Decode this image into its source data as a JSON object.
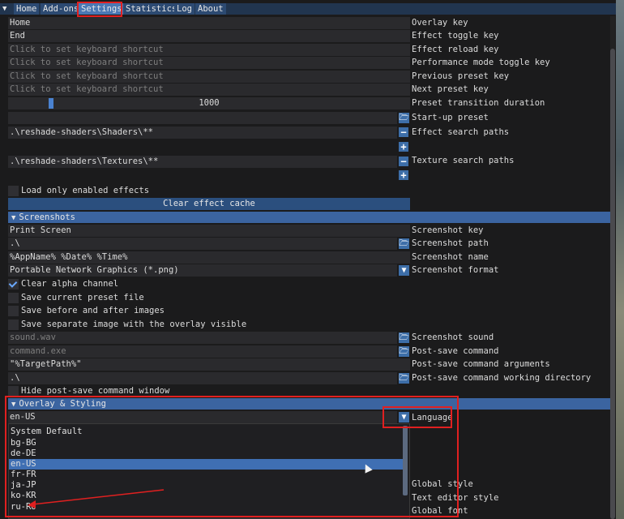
{
  "tabs": [
    {
      "label": "Home"
    },
    {
      "label": "Add-ons"
    },
    {
      "label": "Settings"
    },
    {
      "label": "Statistics"
    },
    {
      "label": "Log"
    },
    {
      "label": "About"
    }
  ],
  "general": {
    "overlay_key_value": "Home",
    "overlay_key_label": "Overlay key",
    "effect_toggle_value": "End",
    "effect_toggle_label": "Effect toggle key",
    "effect_reload_placeholder": "Click to set keyboard shortcut",
    "effect_reload_label": "Effect reload key",
    "performance_placeholder": "Click to set keyboard shortcut",
    "performance_label": "Performance mode toggle key",
    "prev_preset_placeholder": "Click to set keyboard shortcut",
    "prev_preset_label": "Previous preset key",
    "next_preset_placeholder": "Click to set keyboard shortcut",
    "next_preset_label": "Next preset key",
    "transition_value": "1000",
    "transition_label": "Preset transition duration",
    "startup_preset_value": "",
    "startup_preset_label": "Start-up preset",
    "effect_paths_value": ".\\reshade-shaders\\Shaders\\**",
    "effect_paths_label": "Effect search paths",
    "texture_paths_value": ".\\reshade-shaders\\Textures\\**",
    "texture_paths_label": "Texture search paths",
    "load_enabled_label": "Load only enabled effects",
    "clear_cache_label": "Clear effect cache"
  },
  "screenshots": {
    "header": "Screenshots",
    "key_value": "Print Screen",
    "key_label": "Screenshot key",
    "path_value": ".\\",
    "path_label": "Screenshot path",
    "name_value": "%AppName% %Date% %Time%",
    "name_label": "Screenshot name",
    "format_value": "Portable Network Graphics (*.png)",
    "format_label": "Screenshot format",
    "clear_alpha_label": "Clear alpha channel",
    "save_preset_label": "Save current preset file",
    "save_before_after_label": "Save before and after images",
    "save_separate_label": "Save separate image with the overlay visible",
    "sound_placeholder": "sound.wav",
    "sound_label": "Screenshot sound",
    "post_save_placeholder": "command.exe",
    "post_save_label": "Post-save command",
    "post_save_args_value": "\"%TargetPath%\"",
    "post_save_args_label": "Post-save command arguments",
    "post_save_dir_value": ".\\",
    "post_save_dir_label": "Post-save command working directory",
    "hide_window_label": "Hide post-save command window"
  },
  "overlay": {
    "header": "Overlay & Styling",
    "language_value": "en-US",
    "language_label": "Language",
    "global_style_label": "Global style",
    "text_editor_style_label": "Text editor style",
    "global_font_label": "Global font",
    "languages": [
      {
        "label": "System Default"
      },
      {
        "label": "bg-BG"
      },
      {
        "label": "de-DE"
      },
      {
        "label": "en-US"
      },
      {
        "label": "fr-FR"
      },
      {
        "label": "ja-JP"
      },
      {
        "label": "ko-KR"
      },
      {
        "label": "ru-RU"
      }
    ],
    "selected_language_index": 3
  },
  "colors": {
    "accent": "#3f6fb3",
    "highlight_box": "#e02020"
  }
}
